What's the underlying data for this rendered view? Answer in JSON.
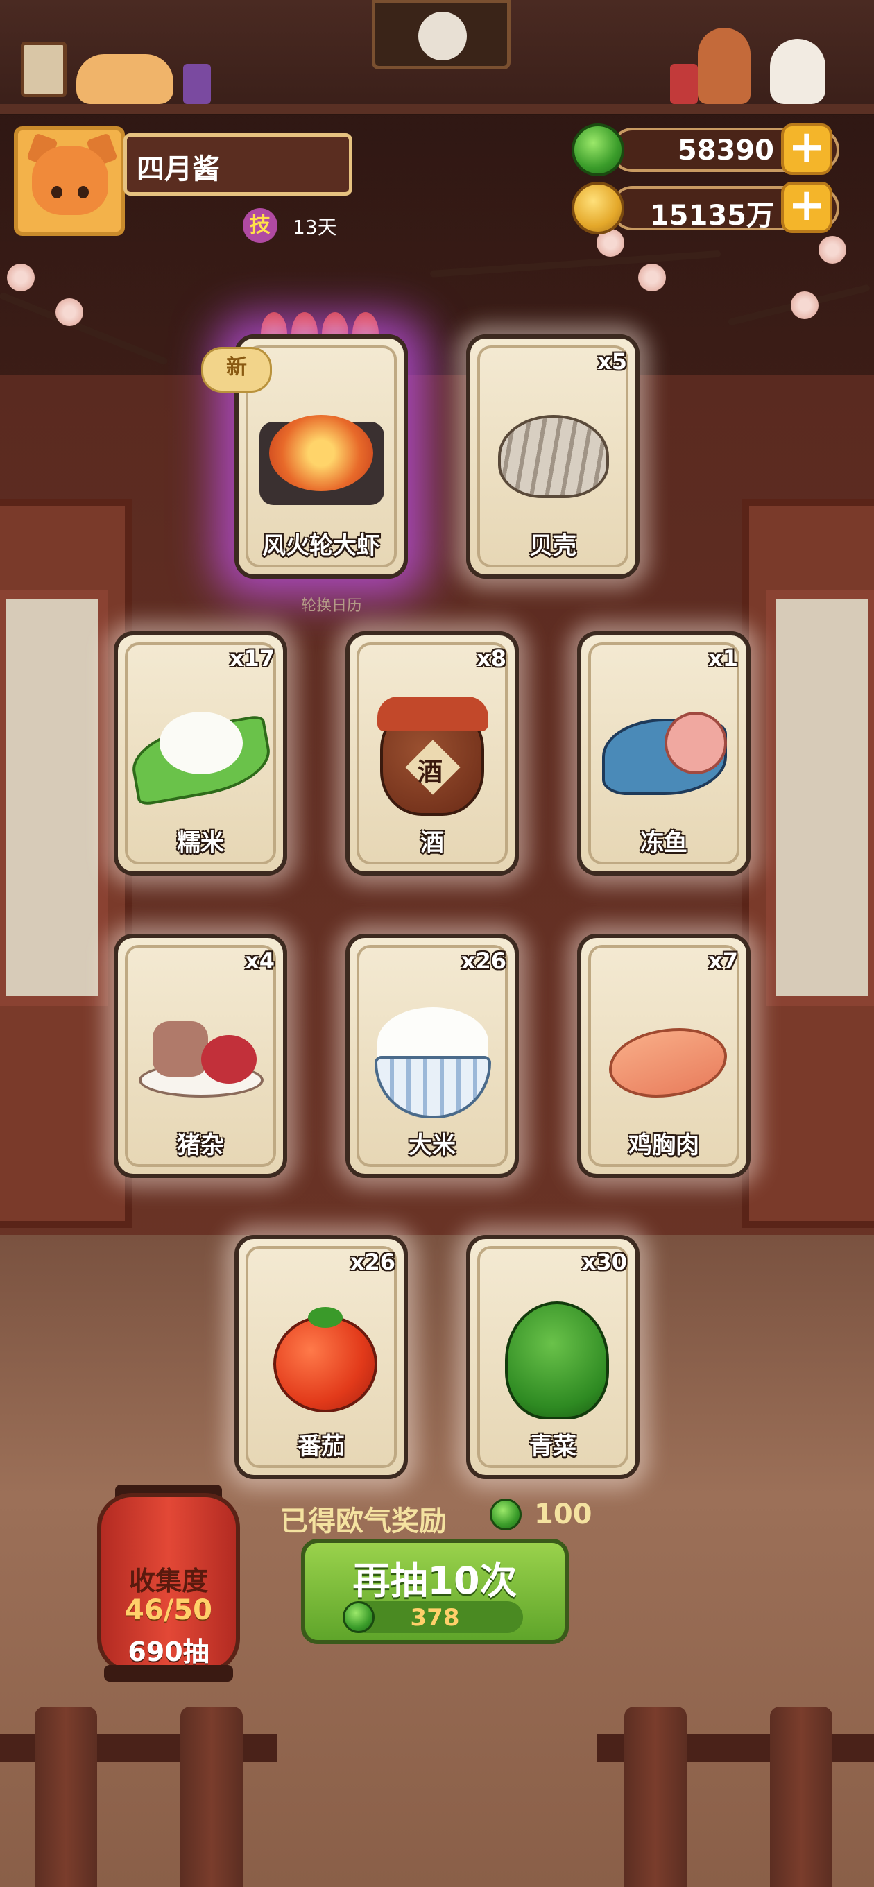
{
  "player": {
    "name": "四月酱",
    "skill_badge": "技",
    "skill_days": "13天"
  },
  "resources": [
    {
      "icon": "jade-coin-icon",
      "value": "58390"
    },
    {
      "icon": "gold-coin-icon",
      "value": "15135万"
    }
  ],
  "new_badge": "新",
  "calendar_label": "轮换日历",
  "cards": [
    {
      "name": "风火轮大虾",
      "qty": "",
      "icon": "grilled-shrimp-icon",
      "special": true
    },
    {
      "name": "贝壳",
      "qty": "x5",
      "icon": "shell-icon"
    },
    {
      "name": "糯米",
      "qty": "x17",
      "icon": "glutinous-rice-icon"
    },
    {
      "name": "酒",
      "qty": "x8",
      "icon": "wine-jar-icon",
      "jar_label": "酒"
    },
    {
      "name": "冻鱼",
      "qty": "x1",
      "icon": "frozen-fish-icon"
    },
    {
      "name": "猪杂",
      "qty": "x4",
      "icon": "pork-offal-icon"
    },
    {
      "name": "大米",
      "qty": "x26",
      "icon": "rice-bowl-icon"
    },
    {
      "name": "鸡胸肉",
      "qty": "x7",
      "icon": "chicken-breast-icon"
    },
    {
      "name": "番茄",
      "qty": "x26",
      "icon": "tomato-icon"
    },
    {
      "name": "青菜",
      "qty": "x30",
      "icon": "greens-icon"
    }
  ],
  "collection": {
    "title": "收集度",
    "progress": "46/50",
    "draws": "690抽"
  },
  "reward": {
    "label": "已得欧气奖励",
    "value": "100"
  },
  "draw_button": {
    "label": "再抽10次",
    "cost": "378"
  },
  "colors": {
    "draw_button": "#7cbc3a",
    "lantern": "#d9402f",
    "special_glow": "#be50e6"
  }
}
